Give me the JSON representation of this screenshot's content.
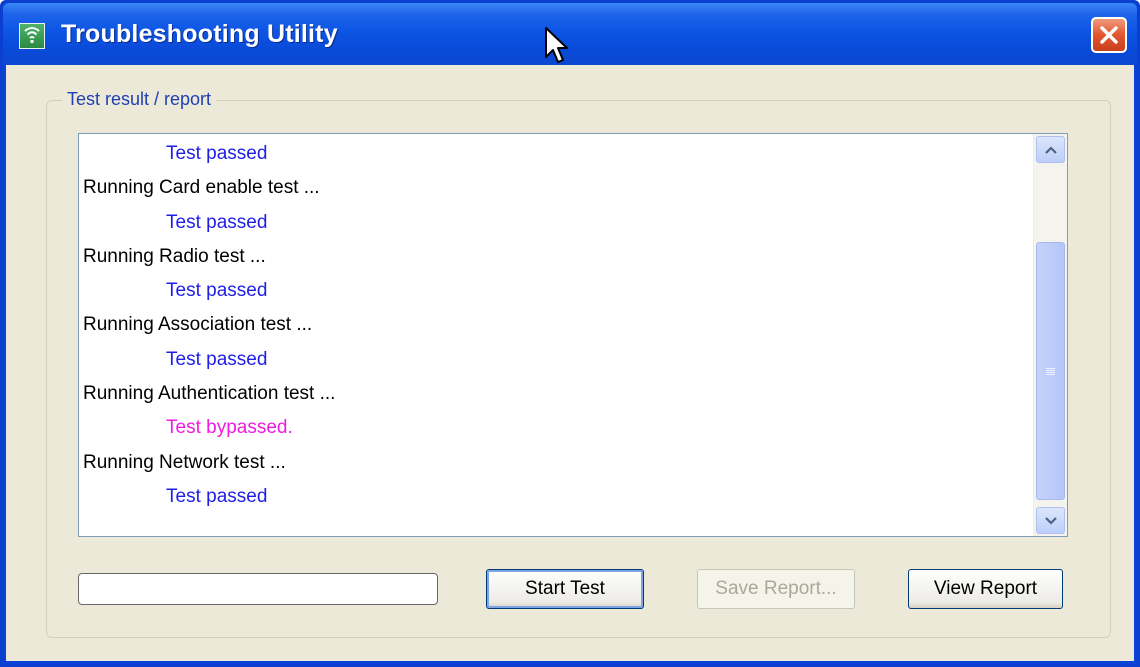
{
  "window": {
    "title": "Troubleshooting Utility",
    "close_icon": "close-x-icon",
    "app_icon": "wireless-signal-icon"
  },
  "group": {
    "label": "Test result / report"
  },
  "log": {
    "lines": [
      {
        "type": "pass",
        "text": "Test passed"
      },
      {
        "type": "run",
        "text": "Running Card enable test ..."
      },
      {
        "type": "pass",
        "text": "Test passed"
      },
      {
        "type": "run",
        "text": "Running Radio test ..."
      },
      {
        "type": "pass",
        "text": "Test passed"
      },
      {
        "type": "run",
        "text": "Running Association test ..."
      },
      {
        "type": "pass",
        "text": "Test passed"
      },
      {
        "type": "run",
        "text": "Running Authentication test ..."
      },
      {
        "type": "bypass",
        "text": "Test bypassed."
      },
      {
        "type": "run",
        "text": "Running Network test ..."
      },
      {
        "type": "pass",
        "text": "Test passed"
      }
    ]
  },
  "progress": {
    "fraction": 0
  },
  "buttons": {
    "start": "Start Test",
    "save": "Save Report...",
    "view": "View Report"
  },
  "colors": {
    "run": "#000000",
    "pass": "#1e1ee8",
    "bypass": "#f01ce0",
    "titlebar": "#0a4ad9"
  }
}
